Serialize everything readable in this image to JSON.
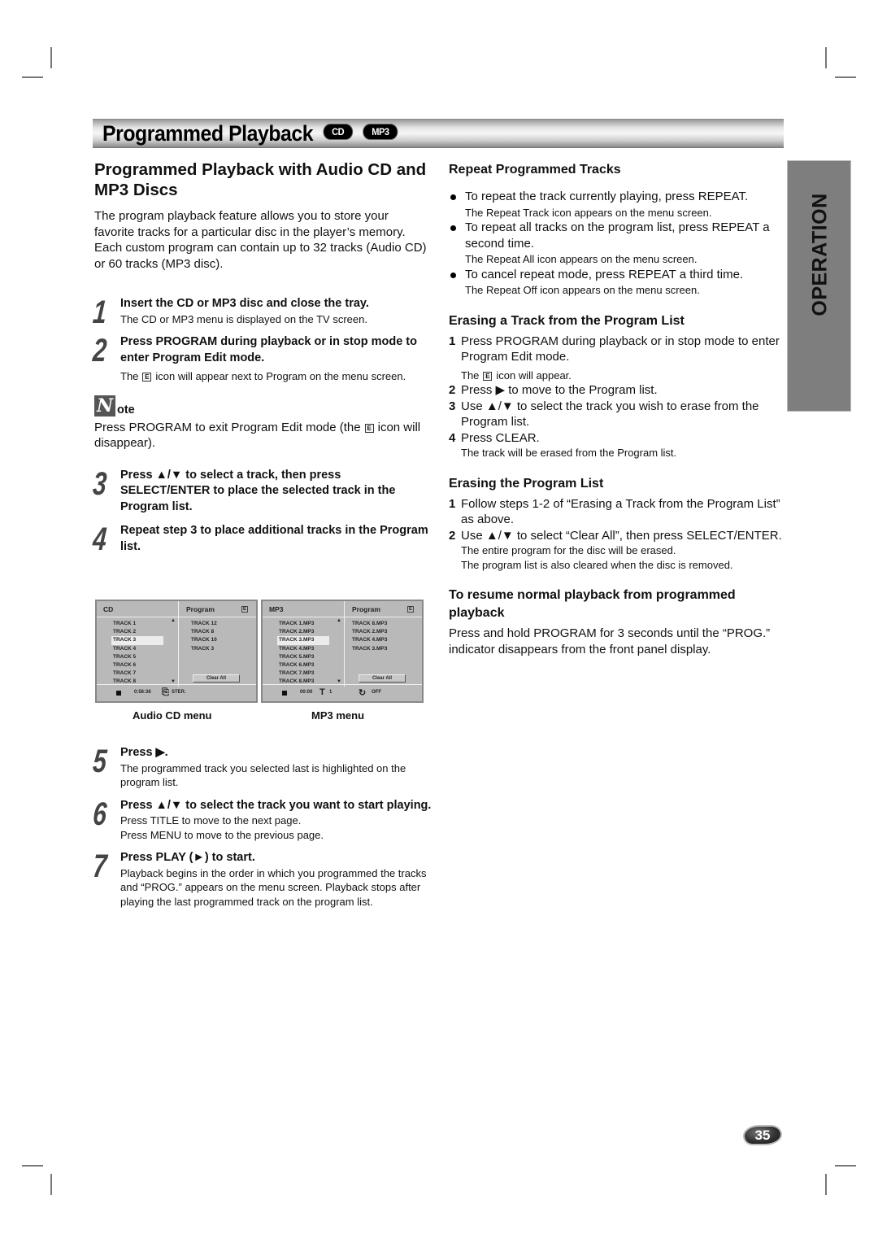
{
  "header": {
    "title": "Programmed Playback",
    "badges": [
      "CD",
      "MP3"
    ]
  },
  "side_tab": "OPERATION",
  "page_number": "35",
  "left": {
    "heading": "Programmed Playback with Audio CD and MP3 Discs",
    "intro": "The program playback feature allows you to store your favorite tracks for a particular disc in the player’s memory. Each custom program can contain up to 32 tracks (Audio CD) or 60 tracks (MP3 disc).",
    "steps": [
      {
        "num": "1",
        "head": "Insert the CD or MP3 disc and close the tray.",
        "body": "The CD or MP3 menu is displayed on the TV screen."
      },
      {
        "num": "2",
        "head": "Press PROGRAM during playback or in stop mode to enter Program Edit mode.",
        "body_pre": "The",
        "body_post": "icon will appear next to Program on the menu screen."
      },
      {
        "num": "3",
        "head": "Press ▲/▼ to select a track, then press SELECT/ENTER to place the selected track in the Program list."
      },
      {
        "num": "4",
        "head": "Repeat step 3 to place additional tracks in the Program list."
      },
      {
        "num": "5",
        "head": "Press ▶.",
        "body": "The programmed track you selected last is highlighted on the program list."
      },
      {
        "num": "6",
        "head": "Press ▲/▼ to select the track you want to start playing.",
        "body_lines": [
          "Press TITLE to move to the next page.",
          "Press MENU to move to the previous page."
        ]
      },
      {
        "num": "7",
        "head": "Press PLAY (►) to start.",
        "body": "Playback begins in the order in which you programmed the tracks and “PROG.” appears on the menu screen. Playback stops after playing the last programmed track on the program list."
      }
    ],
    "note": {
      "icon_letter": "N",
      "label": "ote",
      "text_pre": "Press PROGRAM to exit Program Edit mode (the",
      "text_post": "icon will disappear)."
    },
    "e_icon": "E"
  },
  "menus": {
    "cd": {
      "caption": "Audio CD menu",
      "source_label": "CD",
      "program_label": "Program",
      "edit_icon": "E",
      "tracks": [
        "TRACK 1",
        "TRACK 2",
        "TRACK 3",
        "TRACK 4",
        "TRACK 5",
        "TRACK 6",
        "TRACK 7",
        "TRACK 8"
      ],
      "selected_index": 2,
      "program": [
        "TRACK 12",
        "TRACK 8",
        "TRACK 10",
        "TRACK 3"
      ],
      "clear_all": "Clear All",
      "time": "0:56:36",
      "audio": "STER."
    },
    "mp3": {
      "caption": "MP3 menu",
      "source_label": "MP3",
      "program_label": "Program",
      "edit_icon": "E",
      "tracks": [
        "TRACK 1.MP3",
        "TRACK 2.MP3",
        "TRACK 3.MP3",
        "TRACK 4.MP3",
        "TRACK 5.MP3",
        "TRACK 6.MP3",
        "TRACK 7.MP3",
        "TRACK 8.MP3"
      ],
      "selected_index": 2,
      "program": [
        "TRACK 8.MP3",
        "TRACK 2.MP3",
        "TRACK 4.MP3",
        "TRACK 3.MP3"
      ],
      "clear_all": "Clear All",
      "time": "00:00",
      "title_num": "1",
      "repeat": "OFF"
    }
  },
  "right": {
    "repeat": {
      "heading": "Repeat Programmed Tracks",
      "bullets": [
        {
          "text": "To repeat the track currently playing, press REPEAT.",
          "sub": "The Repeat Track icon appears on the menu screen."
        },
        {
          "text": "To repeat all tracks on the program list, press REPEAT a second time.",
          "sub": "The Repeat All icon appears on the menu screen."
        },
        {
          "text": "To cancel repeat mode, press REPEAT a third time.",
          "sub": "The Repeat Off icon appears on the menu screen."
        }
      ]
    },
    "erase_track": {
      "heading": "Erasing a Track from the Program List",
      "items": [
        {
          "n": "1",
          "text": "Press PROGRAM during playback or in stop mode to enter Program Edit mode.",
          "sub_pre": "The",
          "sub_post": "icon will appear."
        },
        {
          "n": "2",
          "text": "Press ▶ to move to the Program list."
        },
        {
          "n": "3",
          "text": "Use ▲/▼ to select the track you wish to erase from the Program list."
        },
        {
          "n": "4",
          "text": "Press CLEAR.",
          "sub": "The track will be erased from the Program list."
        }
      ]
    },
    "erase_list": {
      "heading": "Erasing the Program List",
      "items": [
        {
          "n": "1",
          "text": "Follow steps 1-2 of “Erasing a Track from the Program List” as above."
        },
        {
          "n": "2",
          "text": "Use ▲/▼ to select “Clear All”, then press SELECT/ENTER.",
          "subs": [
            "The entire program for the disc will be erased.",
            "The program list is also cleared when the disc is removed."
          ]
        }
      ]
    },
    "resume": {
      "heading": "To resume normal playback from programmed playback",
      "text": "Press and hold PROGRAM for 3 seconds until the “PROG.” indicator disappears from the front panel display."
    }
  }
}
